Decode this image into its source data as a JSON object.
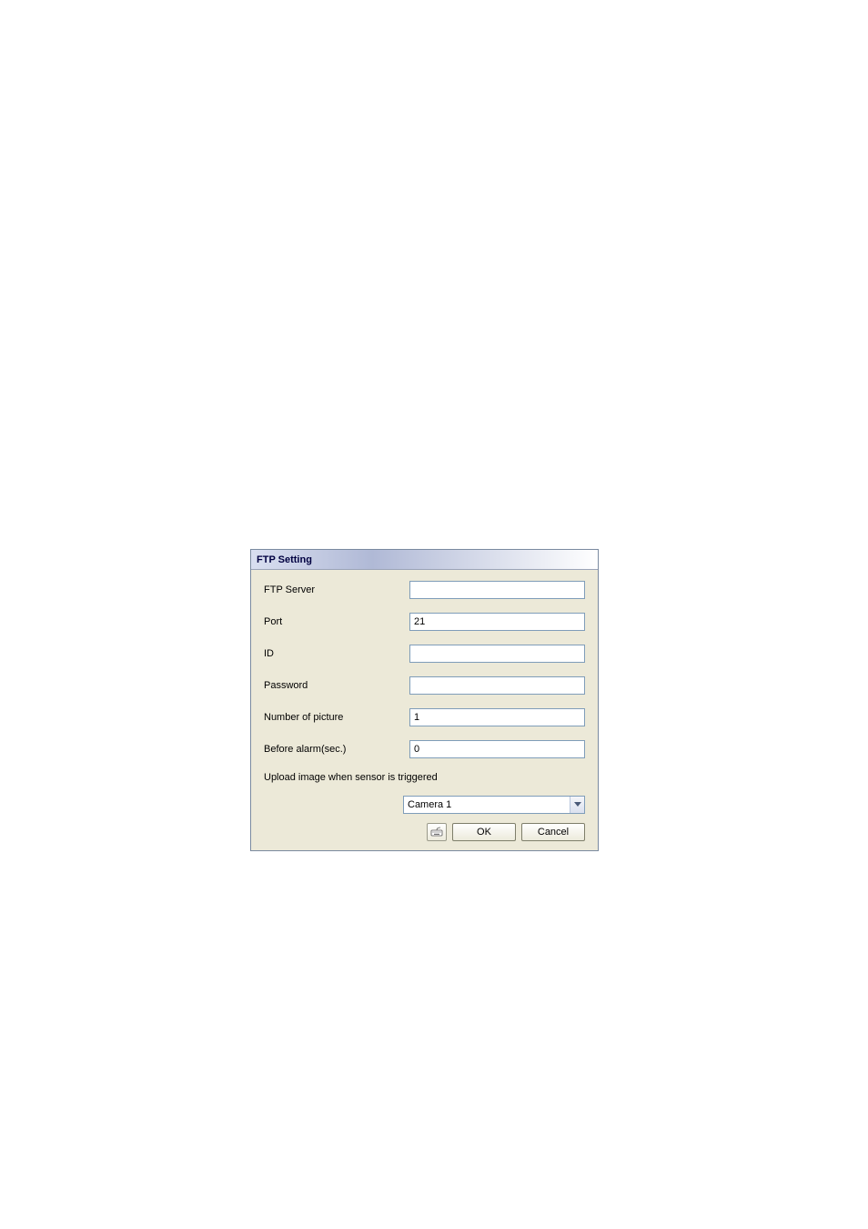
{
  "dialog": {
    "title": "FTP Setting",
    "fields": {
      "ftp_server": {
        "label": "FTP Server",
        "value": ""
      },
      "port": {
        "label": "Port",
        "value": "21"
      },
      "id": {
        "label": "ID",
        "value": ""
      },
      "password": {
        "label": "Password",
        "value": ""
      },
      "number_of_picture": {
        "label": "Number of picture",
        "value": "1"
      },
      "before_alarm": {
        "label": "Before alarm(sec.)",
        "value": "0"
      }
    },
    "upload_label": "Upload image when sensor is triggered",
    "camera_select": {
      "selected": "Camera 1"
    },
    "buttons": {
      "ok": "OK",
      "cancel": "Cancel"
    }
  }
}
